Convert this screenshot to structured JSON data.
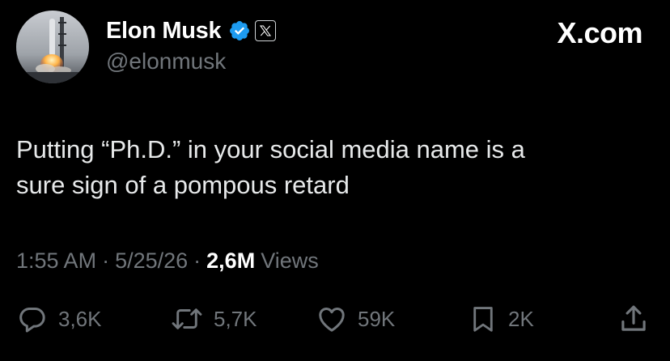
{
  "author": {
    "display_name": "Elon Musk",
    "handle": "@elonmusk",
    "verified_icon": "verified-badge-icon",
    "affiliation_icon": "x-logo-icon"
  },
  "brand": {
    "label": "X.com"
  },
  "tweet": {
    "line1": "Putting “Ph.D.” in your social media name is a",
    "line2": "sure sign of a pompous retard"
  },
  "meta": {
    "time": "1:55 AM",
    "separator": "·",
    "date": "5/25/26",
    "views_count": "2,6M",
    "views_label": "Views"
  },
  "actions": {
    "reply_count": "3,6K",
    "retweet_count": "5,7K",
    "like_count": "59K",
    "bookmark_count": "2K"
  },
  "colors": {
    "background": "#000000",
    "text_primary": "#e7e9ea",
    "text_secondary": "#71767b",
    "verified_blue": "#1d9bf0"
  }
}
